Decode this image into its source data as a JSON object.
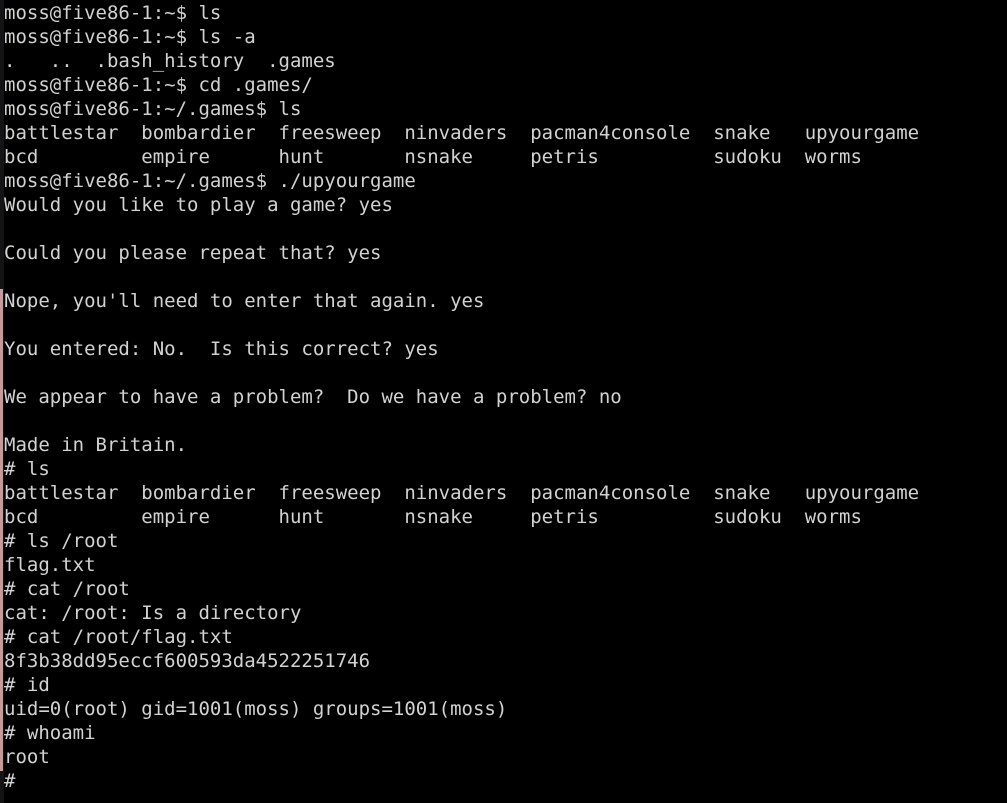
{
  "window": {
    "type": "terminal-emulator",
    "title": "moss@five86-1: ~/.games",
    "colors": {
      "background": "#000000",
      "foreground": "#d2d2d2",
      "scrollbar_track": "#141416",
      "scrollbar_thumb": "#c49a9a"
    },
    "columns": 83,
    "rows": 33
  },
  "scrollbar": {
    "name": "vertical-scrollbar",
    "thumb_top_pct": 36,
    "thumb_height_pct": 60
  },
  "session": {
    "user": "moss",
    "host": "five86-1",
    "user_prompt": "moss@five86-1:~$",
    "games_prompt": "moss@five86-1:~/.games$",
    "root_prompt": "#",
    "flag": "8f3b38dd95eccf600593da4522251746",
    "uid_line": "uid=0(root) gid=1001(moss) groups=1001(moss)",
    "whoami": "root"
  },
  "games_list": {
    "column_1": [
      "battlestar",
      "bcd"
    ],
    "column_2": [
      "bombardier",
      "empire"
    ],
    "column_3": [
      "freesweep",
      "hunt"
    ],
    "column_4": [
      "ninvaders",
      "nsnake"
    ],
    "column_5": [
      "pacman4console",
      "petris"
    ],
    "column_6": [
      "snake",
      "sudoku"
    ],
    "column_7": [
      "upyourgame",
      "worms"
    ]
  },
  "home_listing": [
    ".",
    "..",
    ".bash_history",
    ".games"
  ],
  "lines": [
    "moss@five86-1:~$ ls",
    "moss@five86-1:~$ ls -a",
    ".   ..  .bash_history  .games",
    "moss@five86-1:~$ cd .games/",
    "moss@five86-1:~/.games$ ls",
    "battlestar  bombardier  freesweep  ninvaders  pacman4console  snake   upyourgame",
    "bcd         empire      hunt       nsnake     petris          sudoku  worms",
    "moss@five86-1:~/.games$ ./upyourgame",
    "Would you like to play a game? yes",
    "",
    "Could you please repeat that? yes",
    "",
    "Nope, you'll need to enter that again. yes",
    "",
    "You entered: No.  Is this correct? yes",
    "",
    "We appear to have a problem?  Do we have a problem? no",
    "",
    "Made in Britain.",
    "# ls",
    "battlestar  bombardier  freesweep  ninvaders  pacman4console  snake   upyourgame",
    "bcd         empire      hunt       nsnake     petris          sudoku  worms",
    "# ls /root",
    "flag.txt",
    "# cat /root",
    "cat: /root: Is a directory",
    "# cat /root/flag.txt",
    "8f3b38dd95eccf600593da4522251746",
    "# id",
    "uid=0(root) gid=1001(moss) groups=1001(moss)",
    "# whoami",
    "root",
    "#"
  ]
}
